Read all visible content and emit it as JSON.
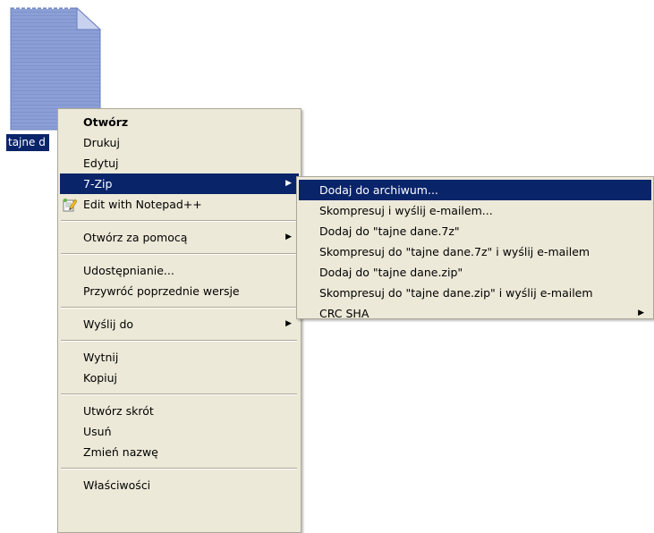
{
  "desktop": {
    "file_label": "tajne d"
  },
  "context_menu": {
    "items": {
      "open": "Otwórz",
      "print": "Drukuj",
      "edit": "Edytuj",
      "sevenzip": "7-Zip",
      "notepadpp": "Edit with Notepad++",
      "open_with": "Otwórz za pomocą",
      "share": "Udostępnianie...",
      "restore": "Przywróć poprzednie wersje",
      "send_to": "Wyślij do",
      "cut": "Wytnij",
      "copy": "Kopiuj",
      "shortcut": "Utwórz skrót",
      "delete": "Usuń",
      "rename": "Zmień nazwę",
      "properties": "Właściwości"
    },
    "highlighted": "7-Zip"
  },
  "submenu": {
    "items": [
      "Dodaj do archiwum...",
      "Skompresuj i wyślij e-mailem...",
      "Dodaj do \"tajne dane.7z\"",
      "Skompresuj do \"tajne dane.7z\" i wyślij e-mailem",
      "Dodaj do \"tajne dane.zip\"",
      "Skompresuj do \"tajne dane.zip\" i wyślij e-mailem",
      "CRC SHA"
    ],
    "highlighted": "Dodaj do archiwum..."
  },
  "icons": {
    "file": "text-file-icon",
    "notepad": "notepad-plus-plus-icon",
    "submenu_arrow": "arrow-right-icon"
  },
  "colors": {
    "menu_background": "#ece9d8",
    "highlight": "#0a246a",
    "highlight_text": "#ffffff",
    "file_icon": "#8b9fd6"
  }
}
